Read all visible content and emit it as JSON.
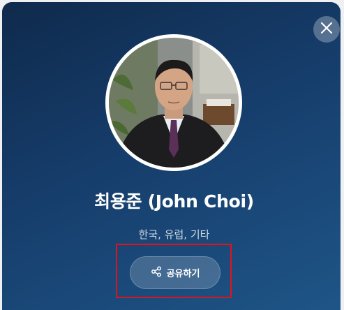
{
  "profile": {
    "name": "최용준 (John Choi)",
    "tags": "한국, 유럽, 기타",
    "share_label": "공유하기"
  },
  "icons": {
    "close": "close-icon",
    "share": "share-icon"
  },
  "colors": {
    "gradient_start": "#0f2a4c",
    "gradient_end": "#1e5587",
    "highlight": "#e3121b"
  }
}
